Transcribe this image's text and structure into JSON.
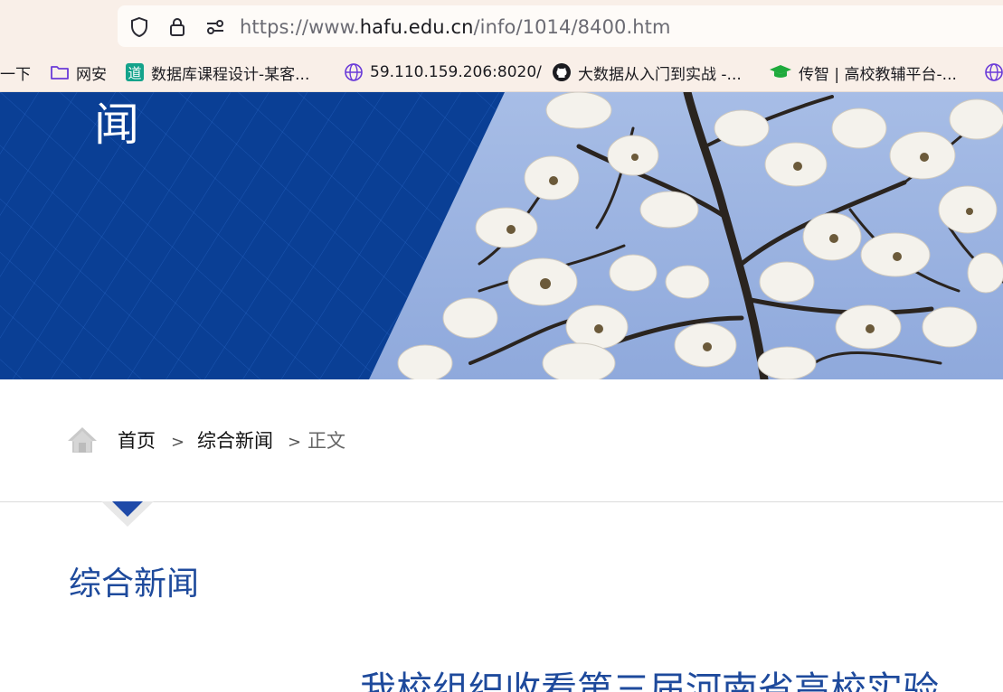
{
  "browser": {
    "url": {
      "prefix": "https://www.",
      "host": "hafu.edu.cn",
      "path": "/info/1014/8400.htm"
    },
    "toolbar_icons": [
      "shield-icon",
      "lock-icon",
      "site-permissions-icon"
    ],
    "bookmarks": [
      {
        "label": "一下",
        "icon": ""
      },
      {
        "label": "网安",
        "icon": "folder-icon"
      },
      {
        "label": "数据库课程设计-某客...",
        "icon": "dao-app-icon"
      },
      {
        "label": "59.110.159.206:8020/",
        "icon": "globe-icon"
      },
      {
        "label": "大数据从入门到实战 -...",
        "icon": "github-icon"
      },
      {
        "label": "传智 | 高校教辅平台-...",
        "icon": "graduation-cap-icon"
      }
    ]
  },
  "banner": {
    "title_char": "闻"
  },
  "breadcrumb": {
    "home": "首页",
    "separator": ">",
    "section": "综合新闻",
    "current": "正文"
  },
  "content": {
    "section_title": "综合新闻",
    "article_title_visible": "我校组织收看第三届河南省高校实验"
  },
  "colors": {
    "banner_blue": "#0a3f95",
    "title_blue": "#1e4a9c",
    "chrome_bg": "#f9efe8"
  }
}
